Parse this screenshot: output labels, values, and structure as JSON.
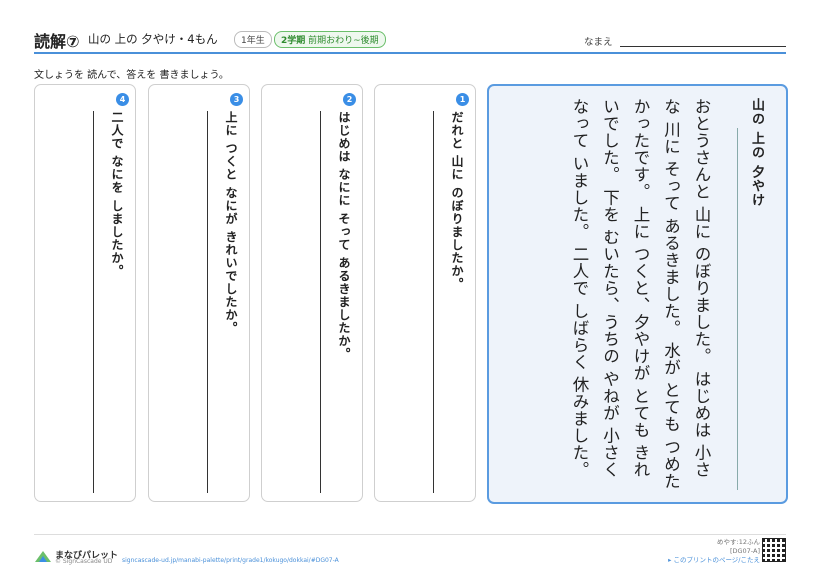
{
  "header": {
    "title": "読解⑦",
    "subtitle": "山の 上の 夕やけ・4もん",
    "grade": "1年生",
    "term_bold": "2学期",
    "term_rest": "前期おわり~後期",
    "name_label": "なまえ"
  },
  "instruction": "文しょうを 読んで、答えを 書きましょう。",
  "story": {
    "title": "山の 上の 夕やけ",
    "text": "おとうさんと 山に のぼりました。 はじめは 小さな 川に そって あるきました。 水が とても つめたかったです。 上に つくと、夕やけが とても きれいでした。 下を むいたら、うちの やねが 小さく なって いました。 二人で しばらく 休みました。"
  },
  "questions": [
    {
      "num": "1",
      "text": "だれと 山に のぼりましたか。"
    },
    {
      "num": "2",
      "text": "はじめは なにに そって あるきましたか。"
    },
    {
      "num": "3",
      "text": "上に つくと なにが きれいでしたか。"
    },
    {
      "num": "4",
      "text": "二人で なにを しましたか。"
    }
  ],
  "footer": {
    "logo": "まなびパレット",
    "copyright": "© SignCascade UD",
    "url": "signcascade-ud.jp/manabi-palette/print/grade1/kokugo/dokkai/#DG07-A",
    "time": "めやす:12ふん",
    "code": "[DG07-A]",
    "link": "▸ このプリントのページ/こたえ"
  },
  "colors": {
    "accent": "#3a8ee6",
    "story_bg": "#eef3fa"
  }
}
